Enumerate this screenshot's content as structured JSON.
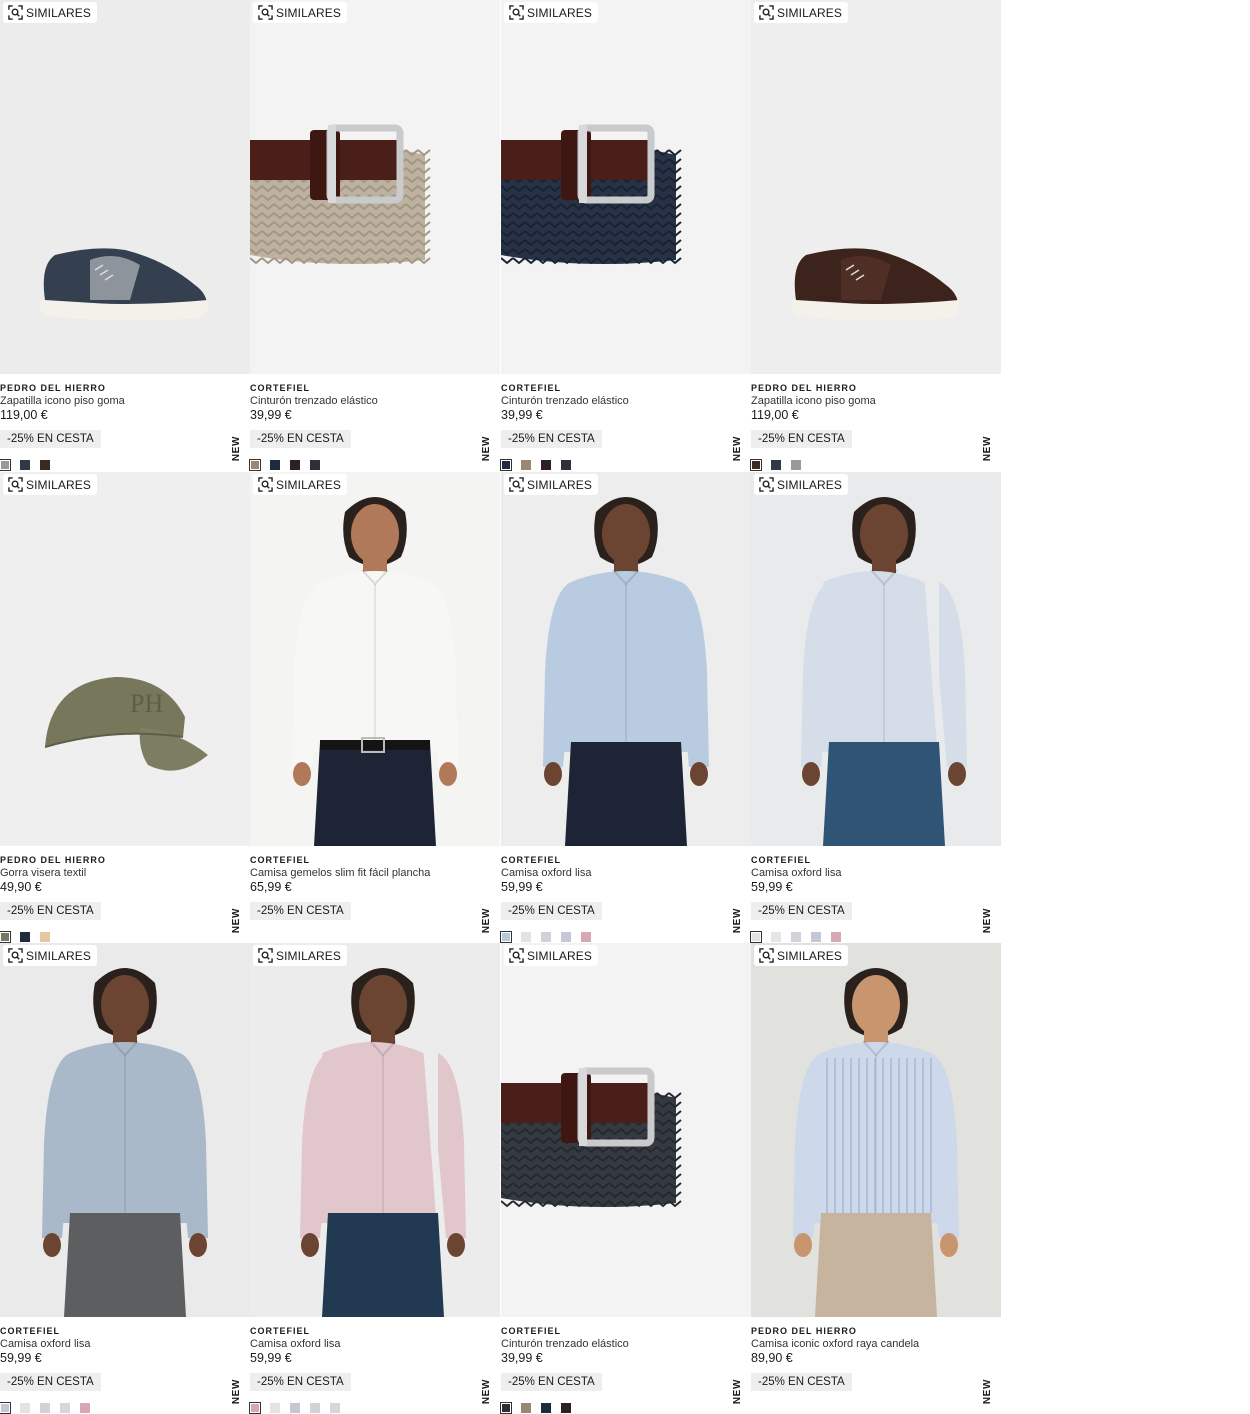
{
  "similar_label": "SIMILARES",
  "new_label": "NEW",
  "products": [
    {
      "brand": "PEDRO DEL HIERRO",
      "name": "Zapatilla icono piso goma",
      "price": "119,00 €",
      "promo": "-25% EN CESTA",
      "image": "sneaker-navy-grey",
      "swatches": [
        "#9a9a96",
        "#2f3a48",
        "#3b2a22"
      ]
    },
    {
      "brand": "CORTEFIEL",
      "name": "Cinturón trenzado elástico",
      "price": "39,99 €",
      "promo": "-25% EN CESTA",
      "image": "braided-belt-beige",
      "swatches": [
        "#9b8772",
        "#1f2a3e",
        "#2b2124",
        "#2d3038"
      ]
    },
    {
      "brand": "CORTEFIEL",
      "name": "Cinturón trenzado elástico",
      "price": "39,99 €",
      "promo": "-25% EN CESTA",
      "image": "braided-belt-navy",
      "swatches": [
        "#1f2a3e",
        "#9b8772",
        "#2b2124",
        "#2d3038"
      ]
    },
    {
      "brand": "PEDRO DEL HIERRO",
      "name": "Zapatilla icono piso goma",
      "price": "119,00 €",
      "promo": "-25% EN CESTA",
      "image": "sneaker-brown",
      "swatches": [
        "#3b2a22",
        "#2f3a48",
        "#9a9a96"
      ]
    },
    {
      "brand": "PEDRO DEL HIERRO",
      "name": "Gorra visera textil",
      "price": "49,90 €",
      "promo": "-25% EN CESTA",
      "image": "cap-khaki",
      "swatches": [
        "#76785f",
        "#1f2a3e",
        "#e4c9a0"
      ]
    },
    {
      "brand": "CORTEFIEL",
      "name": "Camisa gemelos slim fit fácil plancha",
      "price": "65,99 €",
      "promo": "-25% EN CESTA",
      "image": "model-white-shirt",
      "swatches": []
    },
    {
      "brand": "CORTEFIEL",
      "name": "Camisa oxford lisa",
      "price": "59,99 €",
      "promo": "-25% EN CESTA",
      "image": "model-blue-shirt",
      "swatches": [
        "#b9c9dc",
        "#e3e3e3",
        "#cfd3d8",
        "#c3c7d6",
        "#d6a8b3"
      ]
    },
    {
      "brand": "CORTEFIEL",
      "name": "Camisa oxford lisa",
      "price": "59,99 €",
      "promo": "-25% EN CESTA",
      "image": "model-lightblue-shirt-side",
      "swatches": [
        "#e3e3e3",
        "#e6e6ea",
        "#cfd3d8",
        "#c3c7d6",
        "#d6a8b3"
      ]
    },
    {
      "brand": "CORTEFIEL",
      "name": "Camisa oxford lisa",
      "price": "59,99 €",
      "promo": "-25% EN CESTA",
      "image": "model-grey-blue-shirt",
      "swatches": [
        "#c3c7d6",
        "#e3e3e3",
        "#cfd3d8",
        "#d6d7dc",
        "#d6a8b3"
      ]
    },
    {
      "brand": "CORTEFIEL",
      "name": "Camisa oxford lisa",
      "price": "59,99 €",
      "promo": "-25% EN CESTA",
      "image": "model-pink-shirt",
      "swatches": [
        "#d6a8b3",
        "#e3e3e3",
        "#c3c7d6",
        "#cfd3d8",
        "#d6d7dc"
      ]
    },
    {
      "brand": "CORTEFIEL",
      "name": "Cinturón trenzado elástico",
      "price": "39,99 €",
      "promo": "-25% EN CESTA",
      "image": "braided-belt-charcoal",
      "swatches": [
        "#2d3038",
        "#9b8772",
        "#1f2a3e",
        "#2b2124"
      ]
    },
    {
      "brand": "PEDRO DEL HIERRO",
      "name": "Camisa iconic oxford raya candela",
      "price": "89,90 €",
      "promo": "-25% EN CESTA",
      "image": "model-striped-shirt",
      "swatches": []
    }
  ]
}
